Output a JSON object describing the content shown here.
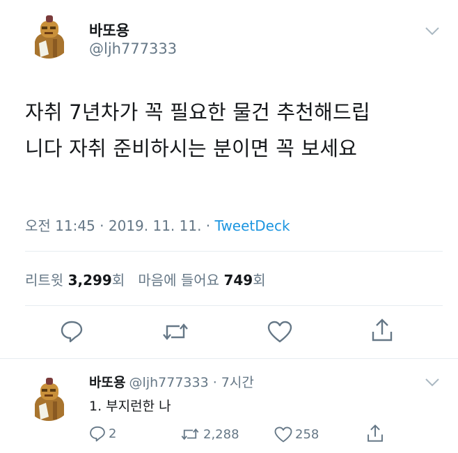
{
  "tweet": {
    "name": "바또용",
    "handle": "@ljh777333",
    "text_line1": "자취 7년차가 꼭 필요한 물건 추천해드립",
    "text_line2": "니다 자취 준비하시는 분이면 꼭 보세요",
    "time": "오전 11:45 · 2019. 11. 11. · ",
    "source": "TweetDeck",
    "retweets_label": "리트윗",
    "retweets_count": "3,299",
    "retweets_unit": "회",
    "likes_label": "마음에 들어요",
    "likes_count": "749",
    "likes_unit": "회"
  },
  "reply": {
    "name": "바또용",
    "handle_time": "@ljh777333 · 7시간",
    "text": "1. 부지런한 나",
    "reply_count": "2",
    "retweet_count": "2,288",
    "like_count": "258"
  },
  "icons": {
    "chevron": "chevron-down-icon",
    "reply": "reply-icon",
    "retweet": "retweet-icon",
    "like": "heart-icon",
    "share": "share-icon"
  },
  "colors": {
    "link": "#1b95e0",
    "secondary_text": "#657786",
    "divider": "#e6ecf0"
  }
}
